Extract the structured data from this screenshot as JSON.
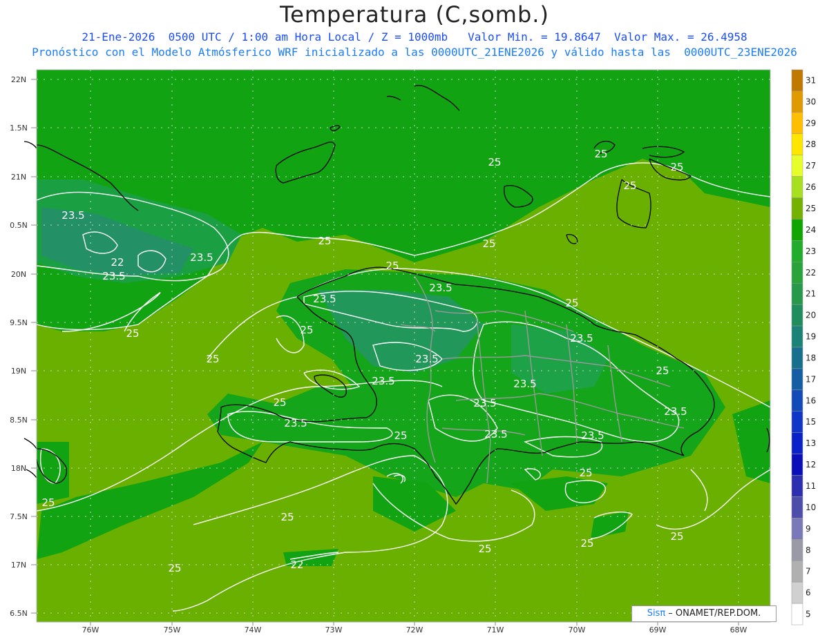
{
  "title": "Temperatura (C,somb.)",
  "subtitle_line1": "21-Ene-2026  0500 UTC / 1:00 am Hora Local / Z = 1000mb   Valor Min. = 19.8647  Valor Max. = 26.4958",
  "subtitle_line2": "Pronóstico con el Modelo Atmósferico WRF inicializado a las 0000UTC_21ENE2026 y válido hasta las  0000UTC_23ENE2026",
  "credit": {
    "brand": "Sisπ",
    "text": " – ONAMET/REP.DOM."
  },
  "axes": {
    "lat_labels": [
      "22N",
      "1.5N",
      "21N",
      "0.5N",
      "20N",
      "9.5N",
      "19N",
      "8.5N",
      "18N",
      "7.5N",
      "17N",
      "6.5N"
    ],
    "lon_labels": [
      "76W",
      "75W",
      "74W",
      "73W",
      "72W",
      "71W",
      "70W",
      "69W",
      "68W"
    ]
  },
  "colorbar": {
    "labels": [
      "31",
      "30",
      "29",
      "28",
      "27",
      "26",
      "25",
      "24",
      "23",
      "22",
      "21",
      "20",
      "19",
      "18",
      "17",
      "16",
      "15",
      "13",
      "12",
      "11",
      "10",
      "9",
      "8",
      "7",
      "6",
      "5"
    ],
    "colors": [
      "#c07800",
      "#e09a00",
      "#ffbf00",
      "#ffe600",
      "#e6ff2a",
      "#a8df20",
      "#74b100",
      "#10a500",
      "#21ad2b",
      "#2aa43a",
      "#269a4a",
      "#208e5c",
      "#1b8276",
      "#176f8e",
      "#145fa4",
      "#134aba",
      "#0f36c6",
      "#0c22c9",
      "#0a0fb8",
      "#2d2fb1",
      "#4d4ea9",
      "#7a78b8",
      "#9a9aa6",
      "#b0b0b0",
      "#d0d0d0",
      "#ffffff"
    ]
  },
  "contour_labels": [
    "25",
    "25",
    "25",
    "25",
    "25",
    "25",
    "25",
    "25",
    "25",
    "25",
    "25",
    "25",
    "25",
    "25",
    "25",
    "25",
    "25",
    "25",
    "25",
    "25",
    "25",
    "23.5",
    "23.5",
    "23.5",
    "23.5",
    "23.5",
    "23.5",
    "23.5",
    "23.5",
    "23.5",
    "23.5",
    "23.5",
    "23.5",
    "23.5",
    "23.5",
    "22",
    "22"
  ]
}
